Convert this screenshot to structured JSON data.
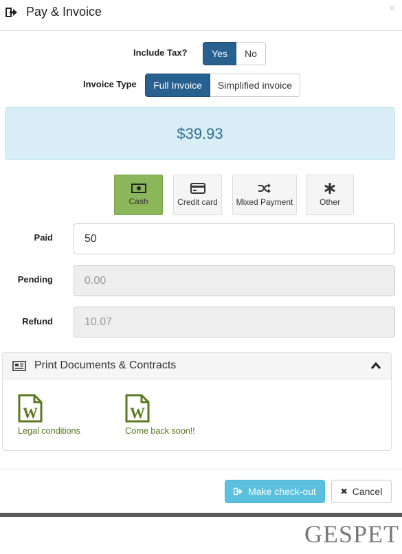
{
  "header": {
    "title": "Pay & Invoice",
    "close_symbol": "×",
    "icon": "sign-out-icon"
  },
  "tax": {
    "label": "Include Tax?",
    "options": [
      "Yes",
      "No"
    ],
    "selected": "Yes"
  },
  "invoice_type": {
    "label": "Invoice Type",
    "options": [
      "Full Invoice",
      "Simplified invoice"
    ],
    "selected": "Full Invoice"
  },
  "total": {
    "amount": "$39.93"
  },
  "payment_methods": [
    {
      "label": "Cash",
      "icon": "money-icon",
      "active": true
    },
    {
      "label": "Credit card",
      "icon": "credit-card-icon",
      "active": false
    },
    {
      "label": "Mixed Payment",
      "icon": "shuffle-icon",
      "active": false
    },
    {
      "label": "Other",
      "icon": "asterisk-icon",
      "active": false
    }
  ],
  "fields": {
    "paid": {
      "label": "Paid",
      "value": "50"
    },
    "pending": {
      "label": "Pending",
      "value": "0.00"
    },
    "refund": {
      "label": "Refund",
      "value": "10.07"
    }
  },
  "documents": {
    "title": "Print Documents & Contracts",
    "items": [
      {
        "label": "Legal conditions",
        "icon": "word-document-icon"
      },
      {
        "label": "Come back soon!!",
        "icon": "word-document-icon"
      }
    ]
  },
  "footer": {
    "checkout_label": "Make check-out",
    "cancel_label": "Cancel",
    "cancel_symbol": "✖"
  },
  "brand": {
    "name": "GESPET"
  },
  "colors": {
    "primary": "#286090",
    "success_green": "#8cb65a",
    "info_bg": "#d9edf7",
    "info_text": "#31708f",
    "checkout": "#5bc0de",
    "doc_green": "#5a7a1f"
  }
}
